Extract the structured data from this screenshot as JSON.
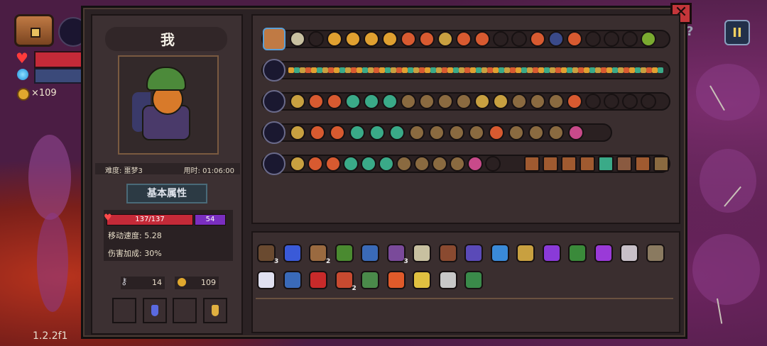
{
  "hud": {
    "coins": "×109",
    "version": "1.2.2f1",
    "pause_label": "II",
    "help_label": "?"
  },
  "panel": {
    "close_label": "✕",
    "player_name": "我",
    "difficulty": "难度: 噩梦3",
    "time_used": "用时: 01:06:00",
    "basic_attributes_title": "基本属性",
    "hp": "137/137",
    "shield": "54",
    "move_speed": "移动速度: 5.28",
    "damage_bonus": "伤害加成: 30%",
    "keys": "14",
    "coins": "109"
  },
  "colors": {
    "health": "#c42a38",
    "shield": "#7a2ec0",
    "gold": "#e0a82e",
    "panel_bg": "#2b2224",
    "close_red": "#c4363a"
  },
  "weapon_rows": [
    {
      "icon": "chest-icon"
    },
    {
      "icon": "ice-staff-icon"
    },
    {
      "icon": "magic-staff-icon"
    },
    {
      "icon": "blue-staff-icon"
    },
    {
      "icon": "dark-sword-icon"
    }
  ],
  "item_counts": [
    "3",
    "2",
    "3",
    "2"
  ]
}
